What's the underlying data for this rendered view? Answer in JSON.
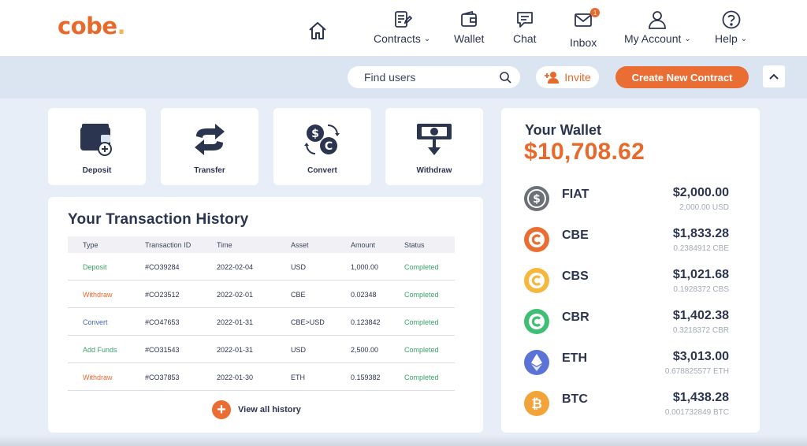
{
  "logo": {
    "text": "cobe",
    "dot": "."
  },
  "nav": {
    "contracts": "Contracts",
    "wallet": "Wallet",
    "chat": "Chat",
    "inbox": "Inbox",
    "inbox_badge": "1",
    "my_account": "My Account",
    "help": "Help",
    "chevron": "⌄"
  },
  "actions": {
    "search_placeholder": "Find users",
    "invite_label": "Invite",
    "create_label": "Create New Contract"
  },
  "quick_actions": [
    {
      "label": "Deposit",
      "icon": "wallet-add-icon"
    },
    {
      "label": "Transfer",
      "icon": "transfer-arrows-icon"
    },
    {
      "label": "Convert",
      "icon": "currency-convert-icon"
    },
    {
      "label": "Withdraw",
      "icon": "cash-withdraw-icon"
    }
  ],
  "history": {
    "title": "Your Transaction History",
    "columns": [
      "Type",
      "Transaction ID",
      "Time",
      "Asset",
      "Amount",
      "Status"
    ],
    "rows": [
      {
        "type": "Deposit",
        "id": "#CO39284",
        "time": "2022-02-04",
        "asset": "USD",
        "amount": "1,000.00",
        "status": "Completed"
      },
      {
        "type": "Withdraw",
        "id": "#CO23512",
        "time": "2022-02-01",
        "asset": "CBE",
        "amount": "0.02348",
        "status": "Completed"
      },
      {
        "type": "Convert",
        "id": "#CO47653",
        "time": "2022-01-31",
        "asset": "CBE>USD",
        "amount": "0.123842",
        "status": "Completed"
      },
      {
        "type": "Add Funds",
        "id": "#CO31543",
        "time": "2022-01-31",
        "asset": "USD",
        "amount": "2,500.00",
        "status": "Completed"
      },
      {
        "type": "Withdraw",
        "id": "#CO37853",
        "time": "2022-01-30",
        "asset": "ETH",
        "amount": "0.159382",
        "status": "Completed"
      }
    ],
    "view_all_label": "View all history"
  },
  "wallet": {
    "title": "Your Wallet",
    "total": "$10,708.62",
    "assets": [
      {
        "name": "FIAT",
        "usd": "$2,000.00",
        "qty": "2,000.00 USD",
        "icon": "dollar-coin-icon",
        "icon_text": "$",
        "color": "#6d7077"
      },
      {
        "name": "CBE",
        "usd": "$1,833.28",
        "qty": "0.2384912 CBE",
        "icon": "cbe-coin-icon",
        "icon_text": "C",
        "color": "#ea6d34"
      },
      {
        "name": "CBS",
        "usd": "$1,021.68",
        "qty": "0.1928372 CBS",
        "icon": "cbs-coin-icon",
        "icon_text": "C",
        "color": "#f5b83d"
      },
      {
        "name": "CBR",
        "usd": "$1,402.38",
        "qty": "0.3218372 CBR",
        "icon": "cbr-coin-icon",
        "icon_text": "C",
        "color": "#3fbf73"
      },
      {
        "name": "ETH",
        "usd": "$3,013.00",
        "qty": "0.678825577 ETH",
        "icon": "ethereum-icon",
        "icon_text": "",
        "color": "#5b72d6"
      },
      {
        "name": "BTC",
        "usd": "$1,438.28",
        "qty": "0.001732849 BTC",
        "icon": "bitcoin-icon",
        "icon_text": "₿",
        "color": "#f2a33a"
      }
    ]
  },
  "colors": {
    "accent": "#e8692c",
    "text": "#2c3550",
    "bar": "#dbe5f1",
    "background": "#e7eef7",
    "completed": "#3aa06a"
  }
}
